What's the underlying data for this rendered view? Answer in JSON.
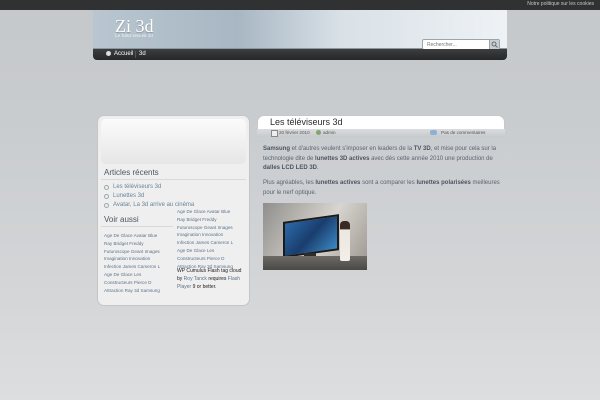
{
  "cookie_notice": "Notre politique sur les cookies",
  "site": {
    "title": "Zi 3d",
    "tagline": "Le futur sera en 3d"
  },
  "search": {
    "placeholder": "Rechercher..."
  },
  "nav": {
    "items": [
      "Accueil",
      "3d"
    ]
  },
  "sidebar": {
    "recent_title": "Articles récents",
    "recent_items": [
      "Les téléviseurs 3d",
      "Lunettes 3d",
      "Avatar, La 3d arrive au cinéma"
    ],
    "see_also_title": "Voir aussi",
    "tags_left": [
      "Age De Glace Avatar Blue",
      "Ray Bridget Freddy",
      "Futuroscope Geant Images",
      "Imagination Innovation",
      "Infection James Cameron L",
      "Age De Glace Les",
      "Constructeurs Pierce D",
      "Attraction Ray 3d Samsung"
    ],
    "tags_right": [
      "Age De Glace Avatar Blue",
      "Ray Bridget Freddy",
      "Futuroscope Geant Images",
      "Imagination Innovation",
      "Infection James Cameron L",
      "Age De Glace Les",
      "Constructeurs Pierce D",
      "Attraction Ray 3d Samsung"
    ],
    "cumulus": {
      "line1": "WP Cumulus Flash tag cloud by",
      "author": "Roy Tanck",
      "requires": "requires",
      "player": "Flash Player",
      "suffix": "9 or better."
    }
  },
  "post": {
    "title": "Les téléviseurs 3d",
    "date": "20 février 2010",
    "author": "admin",
    "comments": "Pas de commentaires",
    "p1": {
      "brand": "Samsung",
      "t1": " et d'autres veulent s'imposer en leaders de la ",
      "k1": "TV 3D",
      "t2": ", et mise pour cela sur la technologie dite de ",
      "k2": "lunettes 3D actives",
      "t3": " avec dès cette année 2010 une production  de ",
      "k3": "dalles LCD LED 3D",
      "t4": "."
    },
    "p2": {
      "t1": "Plus agréables, les ",
      "k1": "lunettes actives",
      "t2": " sont a comparer les ",
      "k2": "lunettes polarisées",
      "t3": " meilleures pour le nerf optique."
    }
  },
  "colors": {
    "header_gradient": "#b9c6d0",
    "navbar": "#2f3133",
    "link": "#5b7388"
  }
}
